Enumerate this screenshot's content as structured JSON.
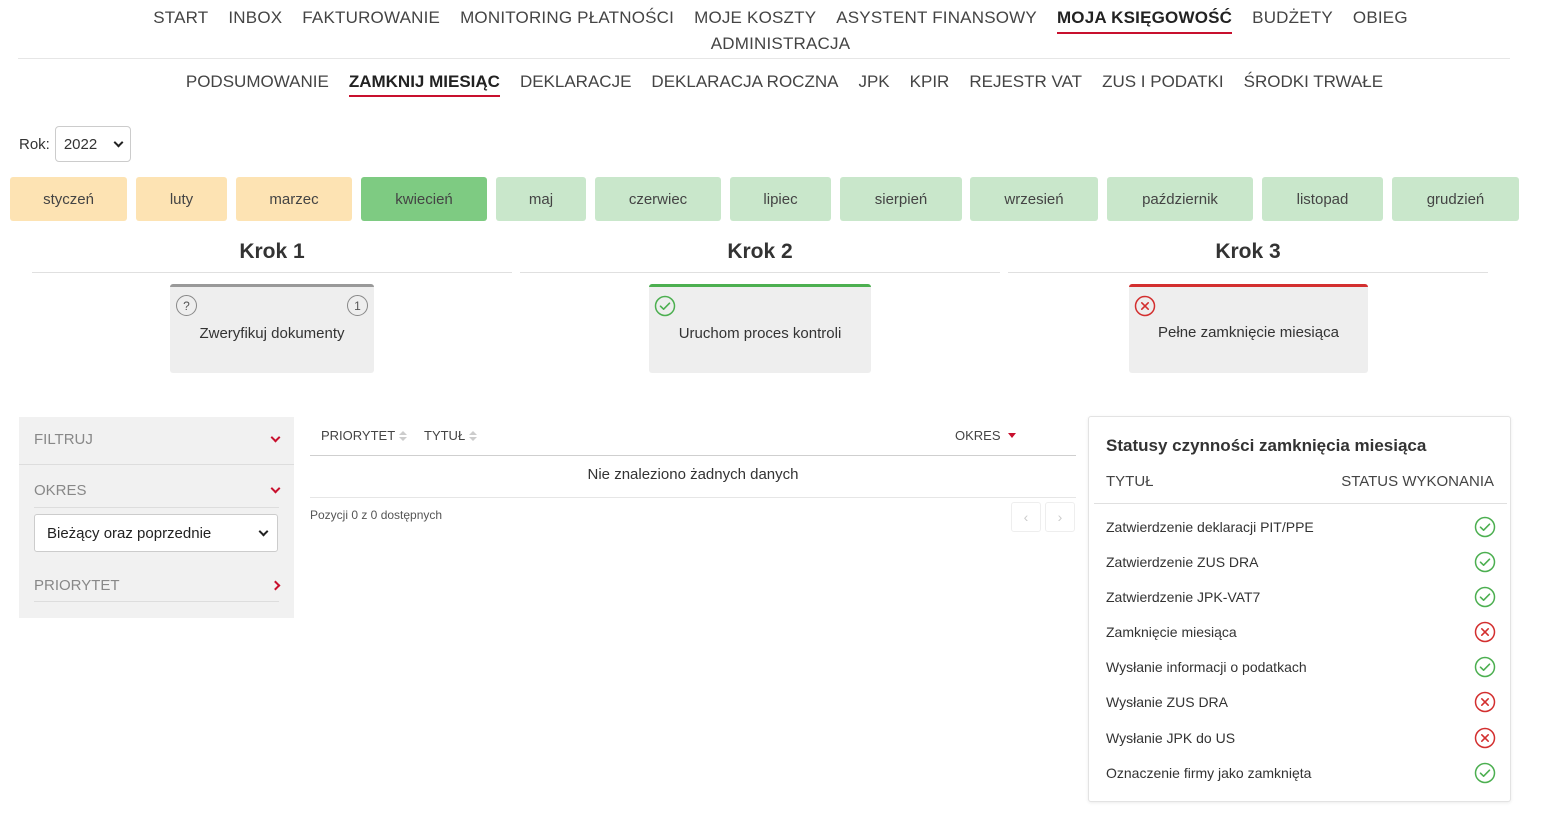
{
  "top_nav": {
    "row1": [
      {
        "label": "START",
        "active": false
      },
      {
        "label": "INBOX",
        "active": false
      },
      {
        "label": "FAKTUROWANIE",
        "active": false
      },
      {
        "label": "MONITORING PŁATNOŚCI",
        "active": false
      },
      {
        "label": "MOJE KOSZTY",
        "active": false
      },
      {
        "label": "ASYSTENT FINANSOWY",
        "active": false
      },
      {
        "label": "MOJA KSIĘGOWOŚĆ",
        "active": true
      },
      {
        "label": "BUDŻETY",
        "active": false
      },
      {
        "label": "OBIEG",
        "active": false
      }
    ],
    "row2": [
      {
        "label": "ADMINISTRACJA",
        "active": false
      }
    ]
  },
  "sub_nav": [
    {
      "label": "PODSUMOWANIE",
      "active": false
    },
    {
      "label": "ZAMKNIJ MIESIĄC",
      "active": true
    },
    {
      "label": "DEKLARACJE",
      "active": false
    },
    {
      "label": "DEKLARACJA ROCZNA",
      "active": false
    },
    {
      "label": "JPK",
      "active": false
    },
    {
      "label": "KPIR",
      "active": false
    },
    {
      "label": "REJESTR VAT",
      "active": false
    },
    {
      "label": "ZUS I PODATKI",
      "active": false
    },
    {
      "label": "ŚRODKI TRWAŁE",
      "active": false
    }
  ],
  "year": {
    "label": "Rok:",
    "value": "2022"
  },
  "months": [
    {
      "label": "styczeń",
      "state": "past"
    },
    {
      "label": "luty",
      "state": "past"
    },
    {
      "label": "marzec",
      "state": "past"
    },
    {
      "label": "kwiecień",
      "state": "current"
    },
    {
      "label": "maj",
      "state": "future"
    },
    {
      "label": "czerwiec",
      "state": "future"
    },
    {
      "label": "lipiec",
      "state": "future"
    },
    {
      "label": "sierpień",
      "state": "future"
    },
    {
      "label": "wrzesień",
      "state": "future"
    },
    {
      "label": "październik",
      "state": "future"
    },
    {
      "label": "listopad",
      "state": "future"
    },
    {
      "label": "grudzień",
      "state": "future"
    }
  ],
  "steps": [
    {
      "title": "Krok 1",
      "card_label": "Zweryfikuj dokumenty",
      "status": "pending",
      "count": "1"
    },
    {
      "title": "Krok 2",
      "card_label": "Uruchom proces kontroli",
      "status": "done"
    },
    {
      "title": "Krok 3",
      "card_label": "Pełne zamknięcie miesiąca",
      "status": "failed"
    }
  ],
  "filters": {
    "filter_label": "FILTRUJ",
    "okres_label": "OKRES",
    "okres_value": "Bieżący oraz poprzednie",
    "priorytet_label": "PRIORYTET"
  },
  "table": {
    "columns": [
      "PRIORYTET",
      "TYTUŁ",
      "OKRES"
    ],
    "empty_message": "Nie znaleziono żadnych danych",
    "pagination_info": "Pozycji 0 z 0 dostępnych",
    "prev_label": "‹",
    "next_label": "›"
  },
  "status_panel": {
    "title": "Statusy czynności zamknięcia miesiąca",
    "col_title": "TYTUŁ",
    "col_status": "STATUS WYKONANIA",
    "rows": [
      {
        "label": "Zatwierdzenie deklaracji PIT/PPE",
        "status": "ok"
      },
      {
        "label": "Zatwierdzenie ZUS DRA",
        "status": "ok"
      },
      {
        "label": "Zatwierdzenie JPK-VAT7",
        "status": "ok"
      },
      {
        "label": "Zamknięcie miesiąca",
        "status": "error"
      },
      {
        "label": "Wysłanie informacji o podatkach",
        "status": "ok"
      },
      {
        "label": "Wysłanie ZUS DRA",
        "status": "error"
      },
      {
        "label": "Wysłanie JPK do US",
        "status": "error"
      },
      {
        "label": "Oznaczenie firmy jako zamknięta",
        "status": "ok"
      }
    ]
  },
  "colors": {
    "accent_red": "#c8102e",
    "ok_green": "#4caf50",
    "error_red": "#d32f2f",
    "month_past": "#fde3b3",
    "month_current": "#7ecb82",
    "month_future": "#c9e7cb"
  }
}
